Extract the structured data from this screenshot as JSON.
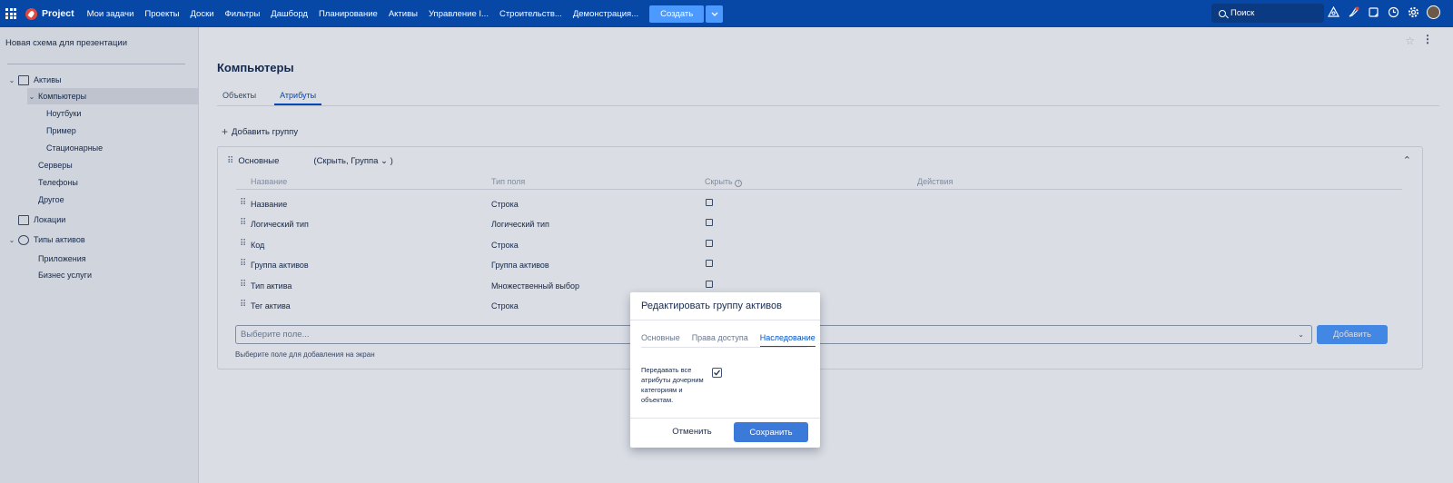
{
  "topbar": {
    "app_name": "Project",
    "nav": [
      "Мои задачи",
      "Проекты",
      "Доски",
      "Фильтры",
      "Дашборд",
      "Планирование",
      "Активы",
      "Управление І...",
      "Строительств...",
      "Демонстрация..."
    ],
    "create_label": "Создать",
    "search_placeholder": "Поиск"
  },
  "sidebar": {
    "schema_title": "Новая схема для презентации",
    "items": [
      {
        "label": "Активы",
        "chevron": "⌄",
        "icon": "computer-icon"
      },
      {
        "label": "Компьютеры",
        "chevron": "⌄",
        "selected": true
      },
      {
        "label": "Ноутбуки"
      },
      {
        "label": "Пример"
      },
      {
        "label": "Стационарные"
      },
      {
        "label": "Серверы"
      },
      {
        "label": "Телефоны"
      },
      {
        "label": "Другое"
      },
      {
        "label": "Локации",
        "icon": "building-icon"
      },
      {
        "label": "Типы активов",
        "chevron": "⌄",
        "icon": "gear-icon"
      },
      {
        "label": "Приложения"
      },
      {
        "label": "Бизнес услуги"
      }
    ]
  },
  "main": {
    "title": "Компьютеры",
    "tabs": [
      "Объекты",
      "Атрибуты"
    ],
    "active_tab": "Атрибуты",
    "add_group_label": "Добавить группу",
    "group": {
      "name": "Основные",
      "meta": "(Скрыть, Группа ⌄ )"
    },
    "table": {
      "headers": [
        "Название",
        "Тип поля",
        "Скрыть",
        "Действия"
      ],
      "rows": [
        {
          "name": "Название",
          "type": "Строка"
        },
        {
          "name": "Логический тип",
          "type": "Логический тип"
        },
        {
          "name": "Код",
          "type": "Строка"
        },
        {
          "name": "Группа активов",
          "type": "Группа активов"
        },
        {
          "name": "Тип актива",
          "type": "Множественный выбор"
        },
        {
          "name": "Тег актива",
          "type": "Строка"
        }
      ]
    },
    "select_placeholder": "Выберите поле...",
    "add_button": "Добавить",
    "help_text": "Выберите поле для добавления на экран"
  },
  "dialog": {
    "title": "Редактировать группу активов",
    "tabs": [
      "Основные",
      "Права доступа",
      "Наследование"
    ],
    "active_tab": "Наследование",
    "inherit_label": "Передавать все атрибуты дочерним категориям и объектам.",
    "inherit_checked": true,
    "cancel_label": "Отменить",
    "save_label": "Сохранить"
  },
  "colors": {
    "topbar": "#0747a6",
    "accent": "#0052cc",
    "button_primary": "#3b7ad9",
    "button_disabled": "#4c9aff"
  }
}
